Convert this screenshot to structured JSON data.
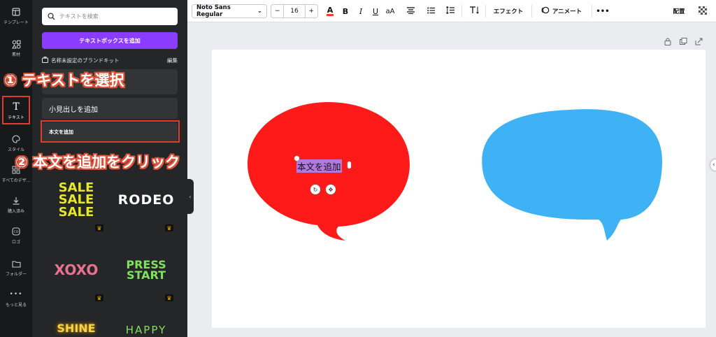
{
  "rail": {
    "items": [
      {
        "label": "テンプレート",
        "icon": "layout-icon"
      },
      {
        "label": "素材",
        "icon": "elements-icon"
      },
      {
        "label": "テキスト",
        "icon": "text-icon"
      },
      {
        "label": "スタイル",
        "icon": "palette-icon"
      },
      {
        "label": "すべてのデザ...",
        "icon": "grid-icon"
      },
      {
        "label": "購入済み",
        "icon": "download-icon"
      },
      {
        "label": "ロゴ",
        "icon": "logo-icon"
      },
      {
        "label": "フォルダー",
        "icon": "folder-icon"
      },
      {
        "label": "もっと見る",
        "icon": "more-icon"
      }
    ]
  },
  "panel": {
    "search_placeholder": "テキストを検索",
    "add_textbox_label": "テキストボックスを追加",
    "brand_kit_label": "名称未設定のブランドキット",
    "edit_label": "編集",
    "add_subheading": "小見出しを追加",
    "add_body": "本文を追加",
    "stickers": [
      {
        "text": "SALE SALE SALE",
        "color": "#e6e62a"
      },
      {
        "text": "RODEO",
        "color": "#ffffff"
      },
      {
        "text": "XOXO",
        "color": "#e8728f"
      },
      {
        "text": "PRESS START",
        "color": "#7ee35b"
      },
      {
        "text": "SHINE",
        "color": "#f2d54a"
      },
      {
        "text": "HAPPY",
        "color": "#7ee35b"
      }
    ]
  },
  "toolbar": {
    "font_name": "Noto Sans Regular",
    "font_size": "16",
    "minus": "−",
    "plus": "+",
    "effects_label": "エフェクト",
    "animate_label": "アニメート",
    "position_label": "配置",
    "more": "•••"
  },
  "canvas": {
    "selected_text": "本文を追加",
    "bubble_left_color": "#ff1a1a",
    "bubble_right_color": "#3eb2f4"
  },
  "annotations": {
    "step1": "① テキストを選択",
    "step2": "② 本文を追加をクリック",
    "color": "#e0523a"
  }
}
